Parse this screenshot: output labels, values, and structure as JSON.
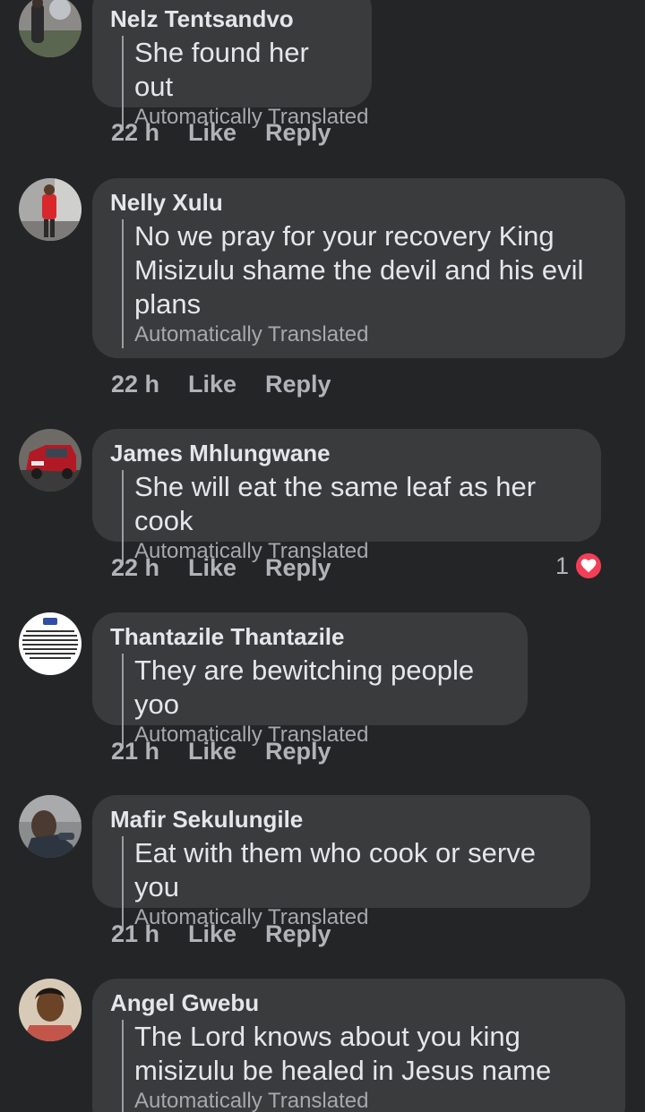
{
  "comments": [
    {
      "author": "Nelz Tentsandvo",
      "text": "She found her out",
      "translated_label": "Automatically Translated",
      "time": "22 h",
      "like_label": "Like",
      "reply_label": "Reply"
    },
    {
      "author": "Nelly Xulu",
      "text": "No we pray for your recovery King Misizulu shame the devil and his evil plans",
      "translated_label": "Automatically Translated",
      "time": "22 h",
      "like_label": "Like",
      "reply_label": "Reply"
    },
    {
      "author": "James Mhlungwane",
      "text": "She will eat the same leaf as her cook",
      "translated_label": "Automatically Translated",
      "time": "22 h",
      "like_label": "Like",
      "reply_label": "Reply",
      "reaction_count": "1",
      "reaction_icon": "heart-icon",
      "reaction_color": "#f33e58"
    },
    {
      "author": "Thantazile Thantazile",
      "text": "They are bewitching people yoo",
      "translated_label": "Automatically Translated",
      "time": "21 h",
      "like_label": "Like",
      "reply_label": "Reply"
    },
    {
      "author": "Mafir Sekulungile",
      "text": "Eat with them who cook or serve you",
      "translated_label": "Automatically Translated",
      "time": "21 h",
      "like_label": "Like",
      "reply_label": "Reply"
    },
    {
      "author": "Angel Gwebu",
      "text": "The Lord knows about you king misizulu be healed in Jesus name",
      "translated_label": "Automatically Translated"
    }
  ],
  "theme": {
    "background": "#242527",
    "bubble": "#3a3b3c",
    "text": "#e4e6eb",
    "secondary_text": "#b0b3b8"
  }
}
